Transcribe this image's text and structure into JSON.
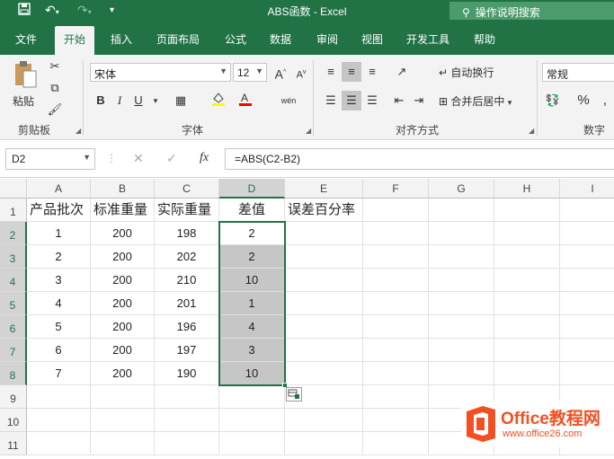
{
  "window": {
    "title": "ABS函数  -  Excel",
    "tell_me": "操作说明搜索"
  },
  "tabs": [
    "文件",
    "开始",
    "插入",
    "页面布局",
    "公式",
    "数据",
    "审阅",
    "视图",
    "开发工具",
    "帮助"
  ],
  "ribbon": {
    "paste_label": "粘贴",
    "clipboard_label": "剪贴板",
    "font_name": "宋体",
    "font_size": "12",
    "font_group_label": "字体",
    "bold": "B",
    "italic": "I",
    "underline": "U",
    "wrap_text": "自动换行",
    "merge_center": "合并后居中",
    "align_group_label": "对齐方式",
    "number_format": "常规",
    "number_group_label": "数字",
    "percent": "%",
    "comma": ","
  },
  "formula_bar": {
    "name_box": "D2",
    "fx": "fx",
    "formula": "=ABS(C2-B2)"
  },
  "columns": [
    "A",
    "B",
    "C",
    "D",
    "E",
    "F",
    "G",
    "H",
    "I"
  ],
  "rows": [
    "1",
    "2",
    "3",
    "4",
    "5",
    "6",
    "7",
    "8",
    "9",
    "10",
    "11"
  ],
  "headers": [
    "产品批次",
    "标准重量",
    "实际重量",
    "差值",
    "误差百分率"
  ],
  "table": [
    [
      "1",
      "200",
      "198",
      "2"
    ],
    [
      "2",
      "200",
      "202",
      "2"
    ],
    [
      "3",
      "200",
      "210",
      "10"
    ],
    [
      "4",
      "200",
      "201",
      "1"
    ],
    [
      "5",
      "200",
      "196",
      "4"
    ],
    [
      "6",
      "200",
      "197",
      "3"
    ],
    [
      "7",
      "200",
      "190",
      "10"
    ]
  ],
  "logo": {
    "brand": "Office教程网",
    "url": "www.office26.com"
  },
  "colors": {
    "accent": "#217346",
    "logo_orange": "#f25022"
  }
}
